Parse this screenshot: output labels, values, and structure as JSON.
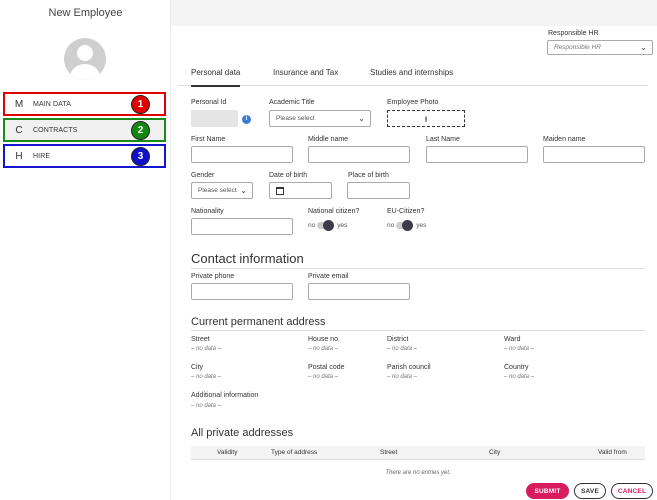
{
  "sidebar": {
    "title": "New Employee",
    "items": [
      {
        "letter": "M",
        "label": "MAIN DATA",
        "badge": "1"
      },
      {
        "letter": "C",
        "label": "CONTRACTS",
        "badge": "2"
      },
      {
        "letter": "H",
        "label": "HIRE",
        "badge": "3"
      }
    ]
  },
  "responsible_hr": {
    "label": "Responsible HR",
    "placeholder": "Responsible HR"
  },
  "tabs": [
    {
      "label": "Personal data",
      "active": true
    },
    {
      "label": "Insurance and Tax"
    },
    {
      "label": "Studies and internships"
    }
  ],
  "personal": {
    "personal_id_label": "Personal Id",
    "academic_title_label": "Academic Title",
    "academic_title_value": "Please select",
    "employee_photo_label": "Employee Photo",
    "first_name_label": "First Name",
    "middle_name_label": "Middle name",
    "last_name_label": "Last Name",
    "maiden_name_label": "Maiden name",
    "gender_label": "Gender",
    "gender_value": "Please select",
    "dob_label": "Date of birth",
    "pob_label": "Place of birth",
    "nationality_label": "Nationality",
    "national_citizen_label": "National citizen?",
    "eu_citizen_label": "EU-Citizen?",
    "no": "no",
    "yes": "yes"
  },
  "contact": {
    "title": "Contact information",
    "private_phone_label": "Private phone",
    "private_email_label": "Private email"
  },
  "address": {
    "title": "Current permanent address",
    "no_data": "– no data –",
    "fields": [
      "Street",
      "House no.",
      "District",
      "Ward",
      "City",
      "Postal code",
      "Parish council",
      "Country"
    ],
    "additional_label": "Additional information"
  },
  "private_addresses": {
    "title": "All private addresses",
    "columns": [
      "Validity",
      "Type of address",
      "Street",
      "City",
      "Valid from"
    ],
    "empty": "There are no entries yet."
  },
  "actions": {
    "submit": "SUBMIT",
    "save": "SAVE",
    "cancel": "CANCEL"
  },
  "colors": {
    "badge1": "#e00000",
    "badge2": "#118811",
    "badge3": "#1010cc",
    "submit": "#d81b5c"
  }
}
